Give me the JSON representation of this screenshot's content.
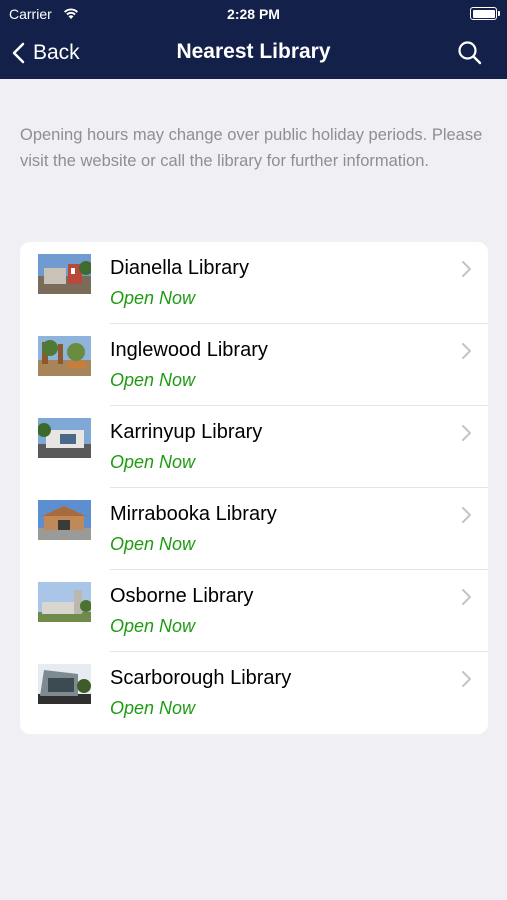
{
  "status_bar": {
    "carrier": "Carrier",
    "time": "2:28 PM"
  },
  "nav": {
    "back_label": "Back",
    "title": "Nearest Library"
  },
  "notice": "Opening hours may change over public holiday periods. Please visit the website or call the library for further information.",
  "libraries": [
    {
      "name": "Dianella Library",
      "status": "Open Now"
    },
    {
      "name": "Inglewood Library",
      "status": "Open Now"
    },
    {
      "name": "Karrinyup Library",
      "status": "Open Now"
    },
    {
      "name": "Mirrabooka Library",
      "status": "Open Now"
    },
    {
      "name": "Osborne Library",
      "status": "Open Now"
    },
    {
      "name": "Scarborough Library",
      "status": "Open Now"
    }
  ],
  "colors": {
    "nav_background": "#13204a",
    "status_open": "#1f9b12",
    "page_background": "#efeff4"
  }
}
